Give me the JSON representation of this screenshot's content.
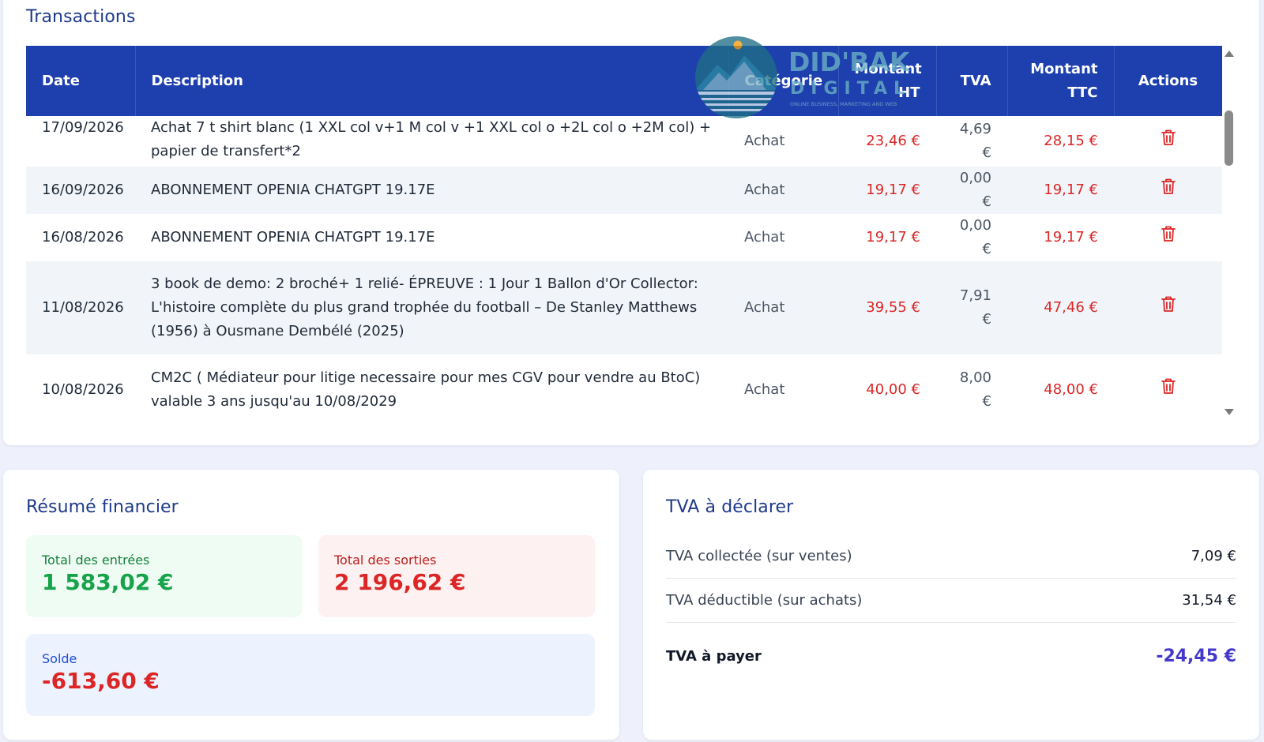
{
  "transactions": {
    "title": "Transactions",
    "columns": {
      "date": "Date",
      "description": "Description",
      "category": "Catégorie",
      "amount_ht": "Montant HT",
      "vat": "TVA",
      "amount_ttc": "Montant TTC",
      "actions": "Actions"
    },
    "rows": [
      {
        "date": "17/09/2026",
        "description": "Achat 7 t shirt blanc (1 XXL col v+1 M col v +1 XXL col o +2L col o +2M col) + papier de transfert*2",
        "category": "Achat",
        "amount_ht": "23,46 €",
        "vat": "4,69 €",
        "amount_ttc": "28,15 €"
      },
      {
        "date": "16/09/2026",
        "description": "ABONNEMENT OPENIA CHATGPT 19.17E",
        "category": "Achat",
        "amount_ht": "19,17 €",
        "vat": "0,00 €",
        "amount_ttc": "19,17 €"
      },
      {
        "date": "16/08/2026",
        "description": "ABONNEMENT OPENIA CHATGPT 19.17E",
        "category": "Achat",
        "amount_ht": "19,17 €",
        "vat": "0,00 €",
        "amount_ttc": "19,17 €"
      },
      {
        "date": "11/08/2026",
        "description": "3 book de demo: 2 broché+ 1 relié- ÉPREUVE : 1 Jour 1 Ballon d'Or Collector: L'histoire complète du plus grand trophée du football – De Stanley Matthews (1956) à Ousmane Dembélé (2025)",
        "category": "Achat",
        "amount_ht": "39,55 €",
        "vat": "7,91 €",
        "amount_ttc": "47,46 €"
      },
      {
        "date": "10/08/2026",
        "description": "CM2C ( Médiateur pour litige necessaire pour mes CGV pour vendre au BtoC) valable 3 ans jusqu'au 10/08/2029",
        "category": "Achat",
        "amount_ht": "40,00 €",
        "vat": "8,00 €",
        "amount_ttc": "48,00 €"
      }
    ],
    "delete_icon": "trash-icon",
    "watermark": {
      "brand": "DID'BAK",
      "sub": "DIGITAL",
      "tagline": "ONLINE BUSINESS, MARKETING AND WEB"
    }
  },
  "summary": {
    "title": "Résumé financier",
    "total_in_label": "Total des entrées",
    "total_in_value": "1 583,02 €",
    "total_out_label": "Total des sorties",
    "total_out_value": "2 196,62 €",
    "balance_label": "Solde",
    "balance_value": "-613,60 €"
  },
  "vat": {
    "title": "TVA à déclarer",
    "collected_label": "TVA collectée (sur ventes)",
    "collected_value": "7,09 €",
    "deductible_label": "TVA déductible (sur achats)",
    "deductible_value": "31,54 €",
    "to_pay_label": "TVA à payer",
    "to_pay_value": "-24,45 €"
  },
  "colors": {
    "header_blue": "#1e40af",
    "title_blue": "#1e3a8a",
    "expense_red": "#dc2626",
    "income_green": "#16a34a",
    "vat_indigo": "#4338ca"
  }
}
